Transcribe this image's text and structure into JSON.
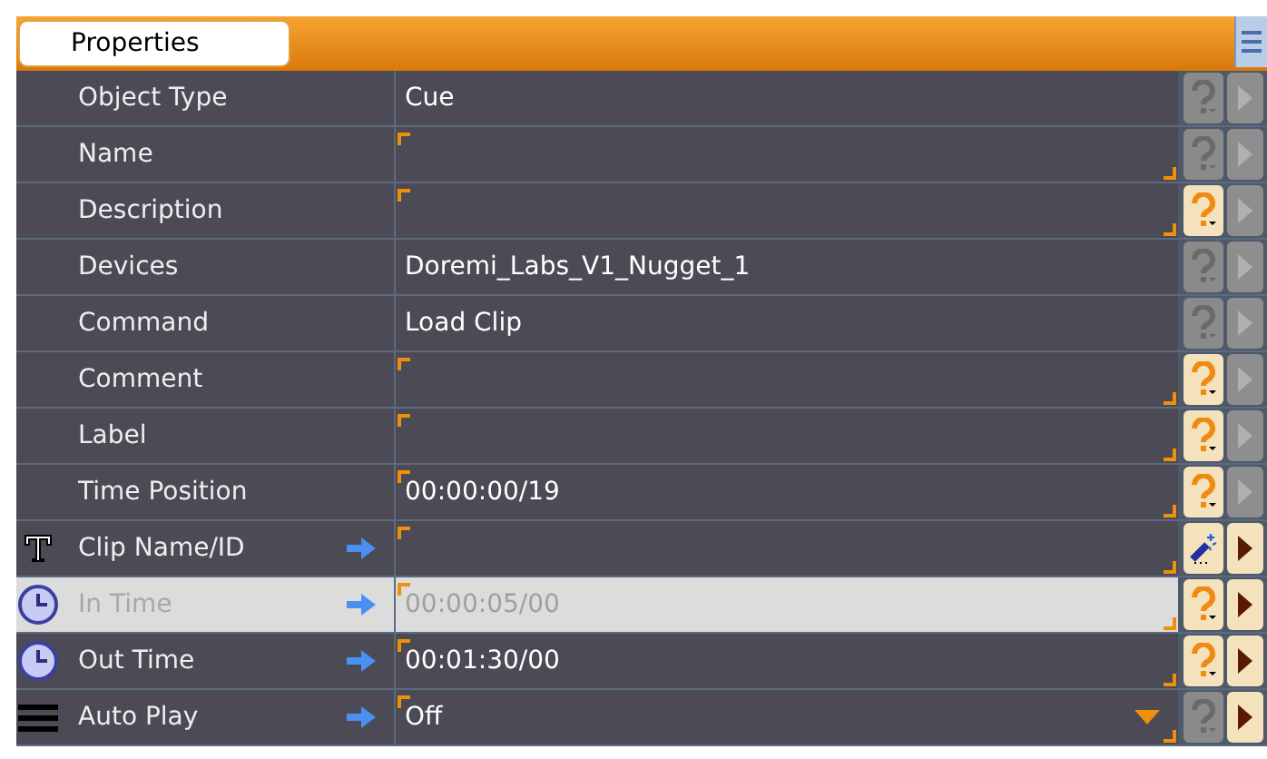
{
  "panel": {
    "title": "Properties"
  },
  "rows": [
    {
      "label": "Object Type",
      "kind": "plain",
      "linked": false,
      "value": "Cue",
      "editable": false,
      "help_button": {
        "kind": "question",
        "active": false
      },
      "play_active": false,
      "selected": false,
      "dropdown": false
    },
    {
      "label": "Name",
      "kind": "plain",
      "linked": false,
      "value": "",
      "editable": true,
      "help_button": {
        "kind": "question",
        "active": false
      },
      "play_active": false,
      "selected": false,
      "dropdown": false
    },
    {
      "label": "Description",
      "kind": "plain",
      "linked": false,
      "value": "",
      "editable": true,
      "help_button": {
        "kind": "question",
        "active": true
      },
      "play_active": false,
      "selected": false,
      "dropdown": false
    },
    {
      "label": "Devices",
      "kind": "plain",
      "linked": false,
      "value": "Doremi_Labs_V1_Nugget_1",
      "editable": false,
      "help_button": {
        "kind": "question",
        "active": false
      },
      "play_active": false,
      "selected": false,
      "dropdown": false
    },
    {
      "label": "Command",
      "kind": "plain",
      "linked": false,
      "value": "Load Clip",
      "editable": false,
      "help_button": {
        "kind": "question",
        "active": false
      },
      "play_active": false,
      "selected": false,
      "dropdown": false
    },
    {
      "label": "Comment",
      "kind": "plain",
      "linked": false,
      "value": "",
      "editable": true,
      "help_button": {
        "kind": "question",
        "active": true
      },
      "play_active": false,
      "selected": false,
      "dropdown": false
    },
    {
      "label": "Label",
      "kind": "plain",
      "linked": false,
      "value": "",
      "editable": true,
      "help_button": {
        "kind": "question",
        "active": true
      },
      "play_active": false,
      "selected": false,
      "dropdown": false
    },
    {
      "label": "Time Position",
      "kind": "plain",
      "linked": false,
      "value": "00:00:00/19",
      "editable": true,
      "help_button": {
        "kind": "question",
        "active": true
      },
      "play_active": false,
      "selected": false,
      "dropdown": false
    },
    {
      "label": "Clip Name/ID",
      "kind": "text",
      "linked": true,
      "value": "",
      "editable": true,
      "help_button": {
        "kind": "wand",
        "active": true
      },
      "play_active": true,
      "selected": false,
      "dropdown": false
    },
    {
      "label": "In Time",
      "kind": "time",
      "linked": true,
      "value": "00:00:05/00",
      "editable": true,
      "help_button": {
        "kind": "question",
        "active": true
      },
      "play_active": true,
      "selected": true,
      "dropdown": false
    },
    {
      "label": "Out Time",
      "kind": "time",
      "linked": true,
      "value": "00:01:30/00",
      "editable": true,
      "help_button": {
        "kind": "question",
        "active": true
      },
      "play_active": true,
      "selected": false,
      "dropdown": false
    },
    {
      "label": "Auto Play",
      "kind": "choice",
      "linked": true,
      "value": "Off",
      "editable": true,
      "help_button": {
        "kind": "question",
        "active": false
      },
      "play_active": true,
      "selected": false,
      "dropdown": true
    }
  ]
}
